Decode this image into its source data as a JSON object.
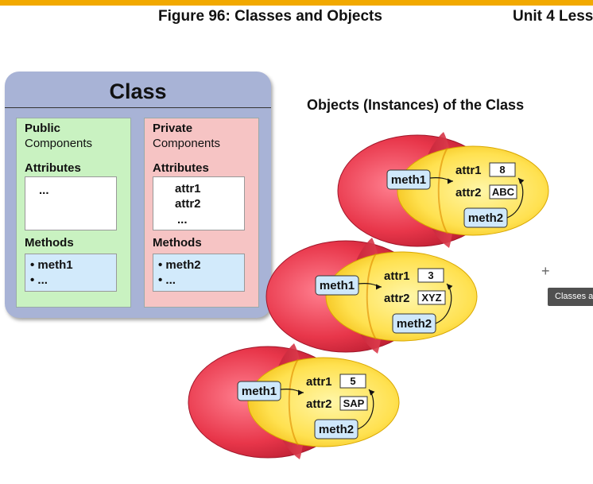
{
  "header": {
    "figure_title": "Figure 96: Classes and Objects",
    "unit_title": "Unit 4 Less",
    "accent_color": "#f2a900"
  },
  "class_diagram": {
    "title": "Class",
    "public": {
      "heading_bold": "Public",
      "heading_regular": "Components",
      "attributes_label": "Attributes",
      "attributes": [
        "..."
      ],
      "methods_label": "Methods",
      "methods": [
        "• meth1",
        "• ..."
      ]
    },
    "private": {
      "heading_bold": "Private",
      "heading_regular": "Components",
      "attributes_label": "Attributes",
      "attributes": [
        "attr1",
        "attr2",
        "..."
      ],
      "methods_label": "Methods",
      "methods": [
        "• meth2",
        "•  ..."
      ]
    }
  },
  "objects": {
    "title": "Objects (Instances) of the Class",
    "instances": [
      {
        "meth1": "meth1",
        "attr1_label": "attr1",
        "attr1_value": "8",
        "attr2_label": "attr2",
        "attr2_value": "ABC",
        "meth2": "meth2"
      },
      {
        "meth1": "meth1",
        "attr1_label": "attr1",
        "attr1_value": "3",
        "attr2_label": "attr2",
        "attr2_value": "XYZ",
        "meth2": "meth2"
      },
      {
        "meth1": "meth1",
        "attr1_label": "attr1",
        "attr1_value": "5",
        "attr2_label": "attr2",
        "attr2_value": "SAP",
        "meth2": "meth2"
      }
    ]
  },
  "tooltip": {
    "text": "Classes an"
  },
  "icons": {
    "cursor": "crosshair-cursor-icon"
  }
}
